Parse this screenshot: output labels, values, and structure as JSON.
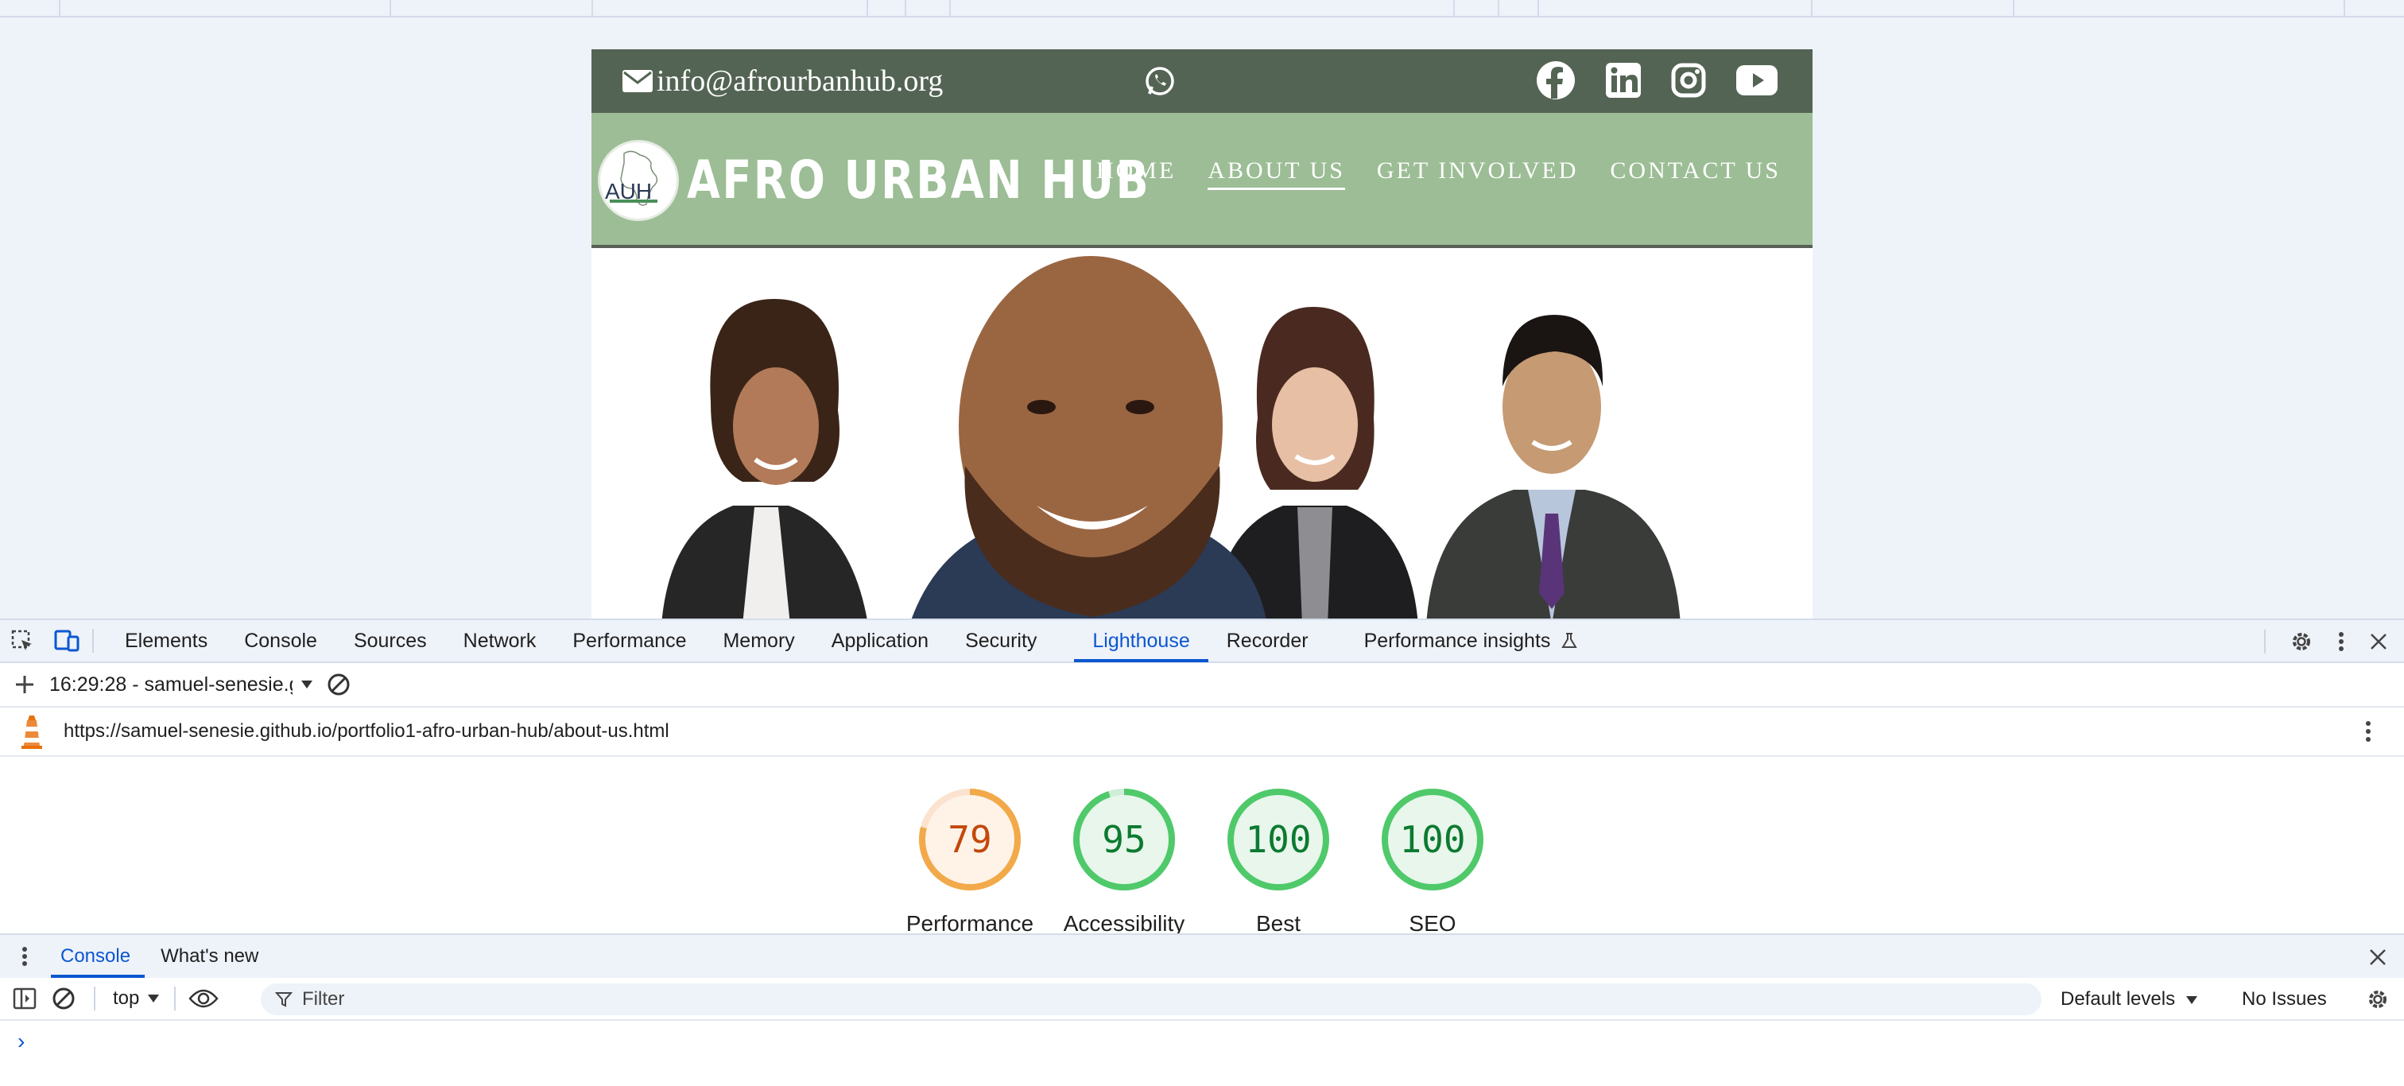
{
  "site": {
    "email": "info@afrourbanhub.org",
    "logo_text": "AUH",
    "brand": "AFRO URBAN HUB",
    "nav": [
      "HOME",
      "ABOUT US",
      "GET INVOLVED",
      "CONTACT US"
    ],
    "active_nav": "ABOUT US",
    "socials": [
      "facebook-icon",
      "linkedin-icon",
      "instagram-icon",
      "youtube-icon"
    ]
  },
  "devtools": {
    "tabs": [
      "Elements",
      "Console",
      "Sources",
      "Network",
      "Performance",
      "Memory",
      "Application",
      "Security",
      "Lighthouse",
      "Recorder",
      "Performance insights"
    ],
    "active_tab": "Lighthouse",
    "report_select": "16:29:28 - samuel-senesie.g",
    "url": "https://samuel-senesie.github.io/portfolio1-afro-urban-hub/about-us.html",
    "scores": [
      {
        "label": "Performance",
        "value": 79,
        "color": "#e8710a"
      },
      {
        "label": "Accessibility",
        "value": 95,
        "color": "#0c8a33"
      },
      {
        "label": "Best",
        "value": 100,
        "color": "#0c8a33"
      },
      {
        "label": "SEO",
        "value": 100,
        "color": "#0c8a33"
      }
    ],
    "drawer": {
      "tabs": [
        "Console",
        "What's new"
      ],
      "context": "top",
      "filter_placeholder": "Filter",
      "levels": "Default levels",
      "issues": "No Issues",
      "prompt": "›"
    }
  },
  "colors": {
    "topbar": "#546454",
    "navbar": "#9cbd95",
    "accent": "#0b57d0"
  }
}
